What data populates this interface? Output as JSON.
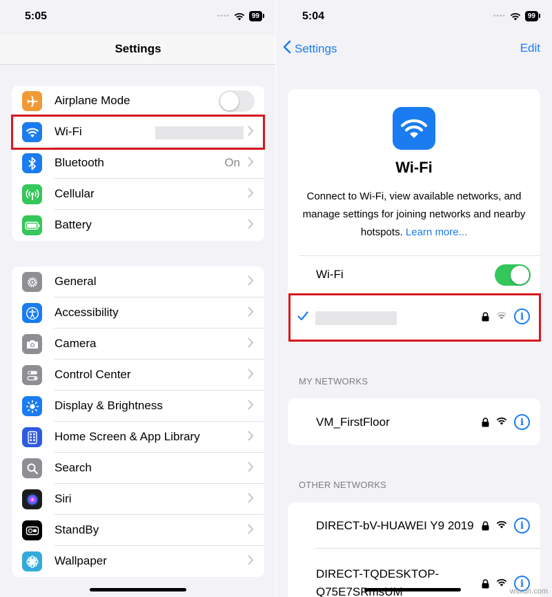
{
  "left": {
    "time": "5:05",
    "battery": "99",
    "title": "Settings",
    "group1": [
      {
        "label": "Airplane Mode",
        "icon": "airplane-icon",
        "color": "#f09a37",
        "control": "toggle-off"
      },
      {
        "label": "Wi-Fi",
        "icon": "wifi-icon",
        "color": "#1a7cf0",
        "control": "redacted"
      },
      {
        "label": "Bluetooth",
        "icon": "bluetooth-icon",
        "color": "#1a7cf0",
        "value": "On"
      },
      {
        "label": "Cellular",
        "icon": "cellular-icon",
        "color": "#34c759"
      },
      {
        "label": "Battery",
        "icon": "battery-icon",
        "color": "#34c759"
      }
    ],
    "group2": [
      {
        "label": "General",
        "icon": "gear-icon",
        "color": "#8e8e93"
      },
      {
        "label": "Accessibility",
        "icon": "accessibility-icon",
        "color": "#1a7cf0"
      },
      {
        "label": "Camera",
        "icon": "camera-icon",
        "color": "#8e8e93"
      },
      {
        "label": "Control Center",
        "icon": "control-center-icon",
        "color": "#8e8e93"
      },
      {
        "label": "Display & Brightness",
        "icon": "sun-icon",
        "color": "#1a7cf0"
      },
      {
        "label": "Home Screen & App Library",
        "icon": "home-screen-icon",
        "color": "#2f5be0"
      },
      {
        "label": "Search",
        "icon": "search-icon",
        "color": "#8e8e93"
      },
      {
        "label": "Siri",
        "icon": "siri-icon",
        "color": "#1c1c1e"
      },
      {
        "label": "StandBy",
        "icon": "standby-icon",
        "color": "#000000"
      },
      {
        "label": "Wallpaper",
        "icon": "wallpaper-icon",
        "color": "#34aadc"
      }
    ]
  },
  "right": {
    "time": "5:04",
    "battery": "99",
    "back_label": "Settings",
    "edit_label": "Edit",
    "hero_title": "Wi-Fi",
    "hero_desc": "Connect to Wi-Fi, view available networks, and manage settings for joining networks and nearby hotspots.",
    "hero_link": "Learn more...",
    "wifi_toggle_label": "Wi-Fi",
    "wifi_toggle_on": true,
    "my_networks_header": "MY NETWORKS",
    "my_networks": [
      {
        "name": "VM_FirstFloor"
      }
    ],
    "other_networks_header": "OTHER NETWORKS",
    "other_networks": [
      {
        "name": "DIRECT-bV-HUAWEI Y9 2019"
      },
      {
        "name": "DIRECT-TQDESKTOP-\nQ75E7SRmsUM"
      }
    ]
  },
  "colors": {
    "accent": "#1a7cf0",
    "highlight": "#d6171d",
    "toggle_on": "#34c759",
    "background": "#f2f2f7"
  },
  "watermark": "wsxdn.com"
}
